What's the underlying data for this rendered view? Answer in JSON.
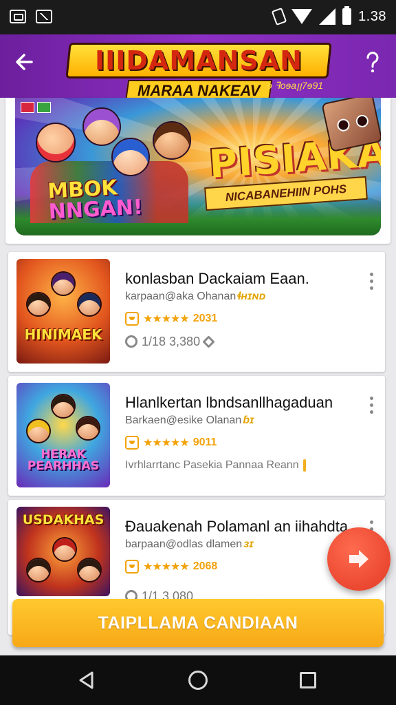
{
  "status_bar": {
    "time": "1.38"
  },
  "header": {
    "title": "IIIDAMANSAN",
    "subtitle": "MARAA NAKEAV",
    "extra_text": "ɘ ꟻoɘaꞁꞁ7ɘ91"
  },
  "banner": {
    "badge_left": "",
    "left_text_line1": "MBOK",
    "left_text_line2": "NNGAN!",
    "right_title": "PISIAKA",
    "right_subtitle": "NICABANEHIIN POHS"
  },
  "list": {
    "items": [
      {
        "thumb_label": "HINIMAEK",
        "title": "konlasban Dackaiam Eaan.",
        "subtitle": "karpaan@aka Ohanan",
        "subtitle_highlight": "ɬʜɪɴᴅ",
        "rating_stars": "★★★★★",
        "rating_text": "2031",
        "meta_text": "1/18 3,380",
        "meta_type": "counts"
      },
      {
        "thumb_label": "HERAK PEARHHAS",
        "title": "Hlanlkertan lbndsanllhagaduan",
        "subtitle": "Barkaen@esike Olanan",
        "subtitle_highlight": "ɓɪ",
        "rating_stars": "★★★★★",
        "rating_text": "9011",
        "meta_text": "Ivrhlarrtanc Pasekia Pannaa Reann",
        "meta_type": "text"
      },
      {
        "thumb_label": "USDAKHAS",
        "title": "Ðauakenah Polamanl an iihahdta",
        "subtitle": "barpaan@odlas dlamen",
        "subtitle_highlight": "ɜɪ",
        "rating_stars": "★★★★★",
        "rating_text": "2068",
        "meta_text": "1/1 3.080",
        "meta_type": "counts"
      }
    ]
  },
  "cta": {
    "label": "TAIPLLAMA CANDIAAN"
  },
  "colors": {
    "header": "#7a27b0",
    "accent": "#f7a816",
    "fab": "#e23a24",
    "star": "#f2a20a"
  }
}
